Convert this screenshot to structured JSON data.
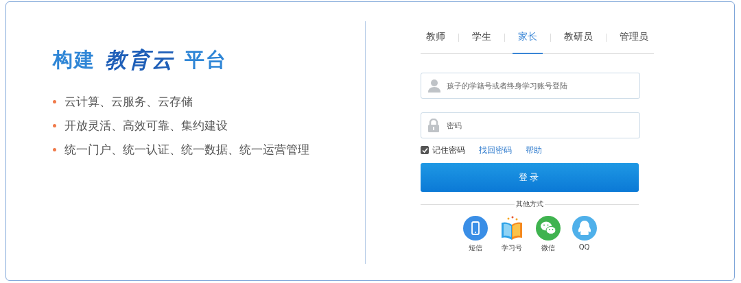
{
  "headline": [
    {
      "text": "构建",
      "kind": "plain"
    },
    {
      "text": "教育云",
      "kind": "script"
    },
    {
      "text": "平台",
      "kind": "plain"
    }
  ],
  "features": [
    "云计算、云服务、云存储",
    "开放灵活、高效可靠、集约建设",
    "统一门户、统一认证、统一数据、统一运营管理"
  ],
  "tabs": [
    {
      "label": "教师",
      "selected": false
    },
    {
      "label": "学生",
      "selected": false
    },
    {
      "label": "家长",
      "selected": true
    },
    {
      "label": "教研员",
      "selected": false
    },
    {
      "label": "管理员",
      "selected": false
    }
  ],
  "account_field": {
    "placeholder": "孩子的学籍号或者终身学习账号登陆"
  },
  "password_field": {
    "placeholder": "密码"
  },
  "remember": {
    "label": "记住密码",
    "checked": true
  },
  "links": [
    "找回密码",
    "帮助"
  ],
  "login_button": "登录",
  "other_methods_label": "其他方式",
  "other_methods": [
    {
      "kind": "sms",
      "label": "短信"
    },
    {
      "kind": "study",
      "label": "学习号"
    },
    {
      "kind": "wechat",
      "label": "微信"
    },
    {
      "kind": "qq",
      "label": "QQ"
    }
  ]
}
